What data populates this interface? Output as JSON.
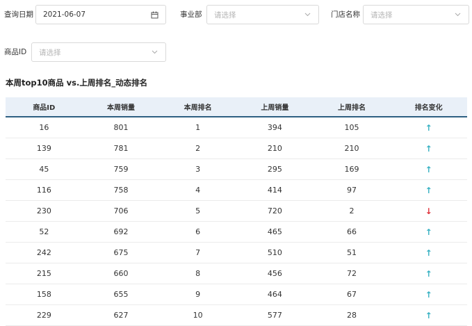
{
  "filters": {
    "query_date": {
      "label": "查询日期",
      "value": "2021-06-07"
    },
    "business_unit": {
      "label": "事业部",
      "placeholder": "请选择"
    },
    "store_name": {
      "label": "门店名称",
      "placeholder": "请选择"
    },
    "product_id": {
      "label": "商品ID",
      "placeholder": "请选择"
    }
  },
  "section_title": "本周top10商品 vs.上周排名_动态排名",
  "table": {
    "headers": [
      "商品ID",
      "本周销量",
      "本周排名",
      "上周销量",
      "上周排名",
      "排名变化"
    ],
    "rows": [
      {
        "id": "16",
        "this_sales": "801",
        "this_rank": "1",
        "last_sales": "394",
        "last_rank": "105",
        "change": "↑",
        "dir": "up"
      },
      {
        "id": "139",
        "this_sales": "781",
        "this_rank": "2",
        "last_sales": "210",
        "last_rank": "210",
        "change": "↑",
        "dir": "up"
      },
      {
        "id": "45",
        "this_sales": "759",
        "this_rank": "3",
        "last_sales": "295",
        "last_rank": "169",
        "change": "↑",
        "dir": "up"
      },
      {
        "id": "116",
        "this_sales": "758",
        "this_rank": "4",
        "last_sales": "414",
        "last_rank": "97",
        "change": "↑",
        "dir": "up"
      },
      {
        "id": "230",
        "this_sales": "706",
        "this_rank": "5",
        "last_sales": "720",
        "last_rank": "2",
        "change": "↓",
        "dir": "down"
      },
      {
        "id": "52",
        "this_sales": "692",
        "this_rank": "6",
        "last_sales": "465",
        "last_rank": "66",
        "change": "↑",
        "dir": "up"
      },
      {
        "id": "242",
        "this_sales": "675",
        "this_rank": "7",
        "last_sales": "510",
        "last_rank": "51",
        "change": "↑",
        "dir": "up"
      },
      {
        "id": "215",
        "this_sales": "660",
        "this_rank": "8",
        "last_sales": "456",
        "last_rank": "72",
        "change": "↑",
        "dir": "up"
      },
      {
        "id": "158",
        "this_sales": "655",
        "this_rank": "9",
        "last_sales": "464",
        "last_rank": "67",
        "change": "↑",
        "dir": "up"
      },
      {
        "id": "229",
        "this_sales": "627",
        "this_rank": "10",
        "last_sales": "577",
        "last_rank": "28",
        "change": "↑",
        "dir": "up"
      }
    ]
  },
  "colors": {
    "up_arrow": "#35b0c2",
    "down_arrow": "#e0323c",
    "header_bg": "#e9f0f8",
    "header_border": "#2e5f82"
  }
}
